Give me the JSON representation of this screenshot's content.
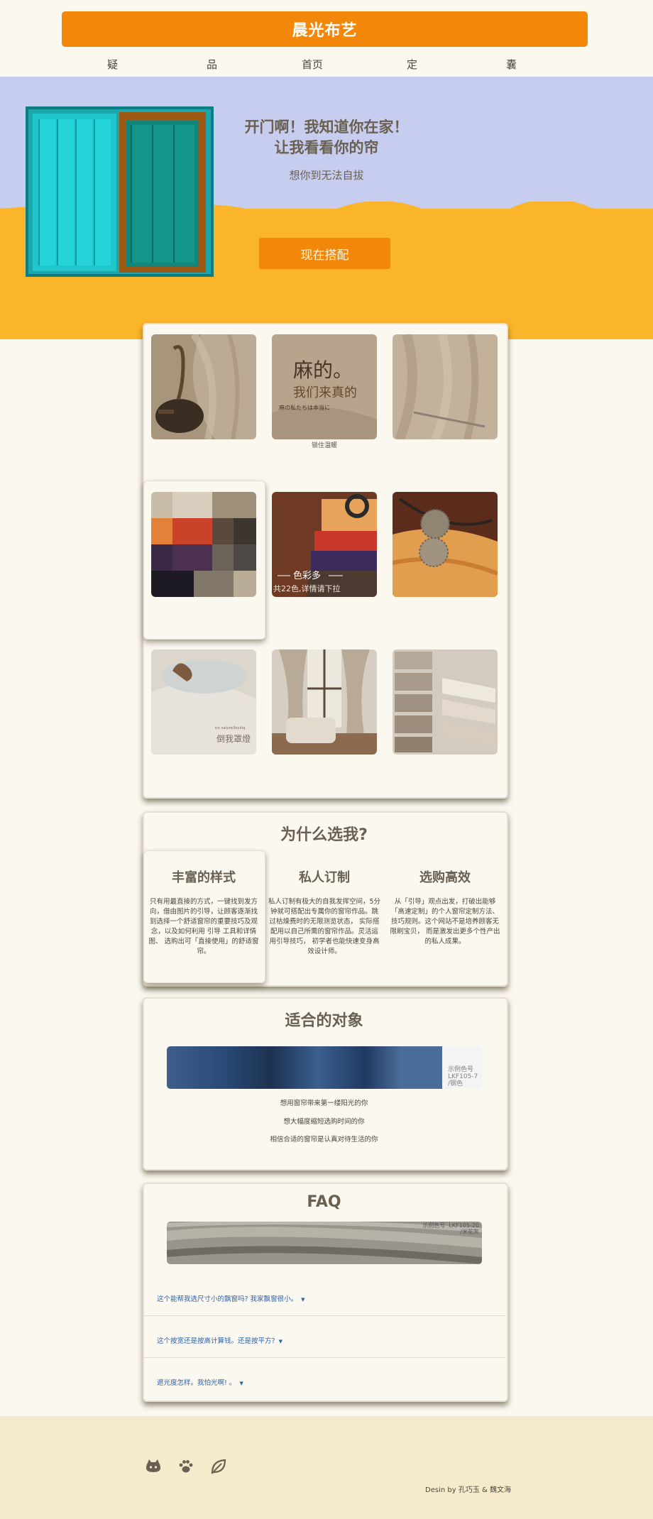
{
  "header": {
    "brand": "晨光布艺",
    "nav": [
      "疑",
      "品",
      "首页",
      "定",
      "囊"
    ],
    "brand_color": "#f2870a"
  },
  "hero": {
    "title_line1": "开门啊！我知道你在家！",
    "title_line2": "让我看看你的帘",
    "subtitle": "想你到无法自拔",
    "cta": "现在搭配",
    "wall_color": "#c7cdee",
    "paint_color": "#fbb52a"
  },
  "gallery": {
    "tiles": [
      {
        "icon": "linen-teapot-photo"
      },
      {
        "icon": "linen-text-photo",
        "overlay_line1": "麻的。",
        "overlay_line2": "我们来真的",
        "overlay_line3": "麻の私たちは本当に",
        "caption": "锁住温暖"
      },
      {
        "icon": "linen-drape-photo"
      },
      {
        "icon": "swatch-grid-photo"
      },
      {
        "icon": "color-fold-photo",
        "overlay_title": "色彩多",
        "overlay_sub": "共22色,详情请下拉"
      },
      {
        "icon": "curtain-tieback-photo"
      },
      {
        "icon": "linen-figurine-photo",
        "overlay_small": "ᥲ≋ nature/boutiq",
        "overlay_label": "倒我罩燈"
      },
      {
        "icon": "living-room-curtain-photo"
      },
      {
        "icon": "folded-fabric-photo"
      }
    ]
  },
  "why": {
    "title": "为什么选我?",
    "features": [
      {
        "title": "丰富的样式",
        "text": "只有用最直接的方式，一键找到发方向，借由图片的引导，让顾客逐渐找到选择一个舒适窗帘的重要技巧及观念，以及如何利用 引导 工具和详情图、 选购出可「直接使用」的舒适窗帘。"
      },
      {
        "title": "私人订制",
        "text": "私人订制有极大的自我发挥空间，5分钟就可搭配出专属你的窗帘作品。跳过枯燥费时的无限测览状态， 实际搭配用以自己所需的窗帘作品。灵活运用引导技巧， 初学者也能快速变身高效设计师。"
      },
      {
        "title": "选购高效",
        "text": "从「引导」观点出发，打破出能够「高速定制」的个人窗帘定制方法、技巧规则。这个网站不是培养顾客无限刷宝贝， 而是激发出更多个性产出的私人成果。"
      }
    ]
  },
  "targets": {
    "title": "适合的对象",
    "banner_label": "示例色号\nLKF105-7\n/钢色",
    "lines": [
      "想用窗帘带来第一缕阳光的你",
      "想大幅度缩短选购时间的你",
      "相信合适的窗帘是认真对待生活的你"
    ]
  },
  "faq": {
    "title": "FAQ",
    "banner_label": "示例色号  LKF105-20\n/米驼灰",
    "items": [
      "这个能帮我选尺寸小的飘窗吗? 我家飘窗很小。",
      "这个按宽还是按高计算钱。还是按平方?",
      "遮光度怎样。我怕光啊! 。"
    ]
  },
  "footer": {
    "icons": [
      "github-cat-icon",
      "paw-icon",
      "leaf-icon"
    ],
    "credit": "Desin by 孔巧玉 & 魏文海"
  }
}
